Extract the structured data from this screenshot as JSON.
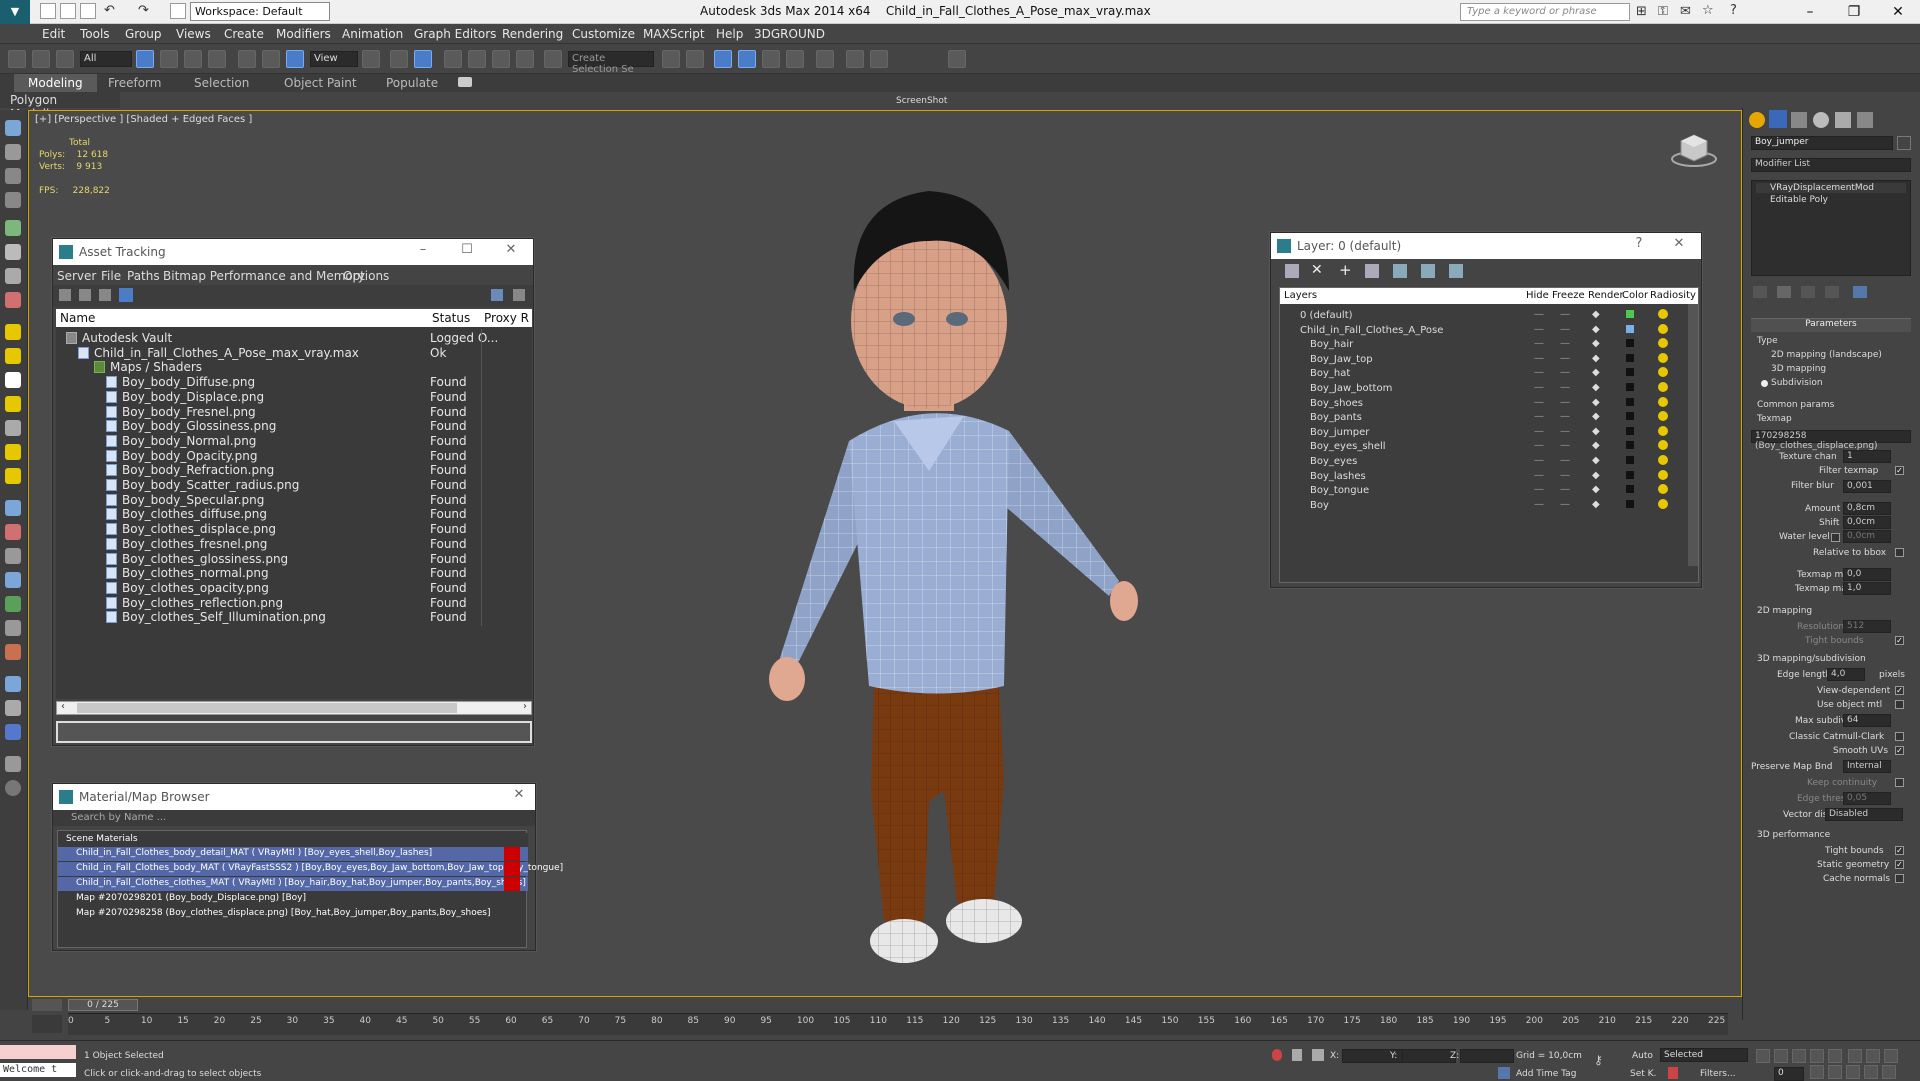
{
  "titlebar": {
    "workspace": "Workspace: Default",
    "app_title": "Autodesk 3ds Max  2014 x64",
    "file_title": "Child_in_Fall_Clothes_A_Pose_max_vray.max",
    "search_placeholder": "Type a keyword or phrase"
  },
  "menu": {
    "items": [
      "Edit",
      "Tools",
      "Group",
      "Views",
      "Create",
      "Modifiers",
      "Animation",
      "Graph Editors",
      "Rendering",
      "Customize",
      "MAXScript",
      "Help",
      "3DGROUND"
    ]
  },
  "toolbar": {
    "selection_filter": "All",
    "ref_coord": "View",
    "create_selection": "Create Selection Se",
    "screenshot_label": "ScreenShot"
  },
  "ribbon": {
    "tabs": [
      "Modeling",
      "Freeform",
      "Selection",
      "Object Paint",
      "Populate"
    ],
    "subtab": "Polygon Modeling"
  },
  "viewport": {
    "label": "[+] [Perspective ] [Shaded + Edged Faces ]",
    "stats_total": "Total",
    "polys_label": "Polys:",
    "polys_value": "12 618",
    "verts_label": "Verts:",
    "verts_value": "9 913",
    "fps_label": "FPS:",
    "fps_value": "228,822"
  },
  "asset_tracking": {
    "title": "Asset Tracking",
    "menu": [
      "Server",
      "File",
      "Paths",
      "Bitmap Performance and Memory",
      "Options"
    ],
    "columns": [
      "Name",
      "Status",
      "Proxy R"
    ],
    "rows": [
      {
        "name": "Autodesk Vault",
        "status": "Logged O..."
      },
      {
        "name": "Child_in_Fall_Clothes_A_Pose_max_vray.max",
        "status": "Ok"
      },
      {
        "name": "Maps / Shaders",
        "status": ""
      },
      {
        "name": "Boy_body_Diffuse.png",
        "status": "Found"
      },
      {
        "name": "Boy_body_Displace.png",
        "status": "Found"
      },
      {
        "name": "Boy_body_Fresnel.png",
        "status": "Found"
      },
      {
        "name": "Boy_body_Glossiness.png",
        "status": "Found"
      },
      {
        "name": "Boy_body_Normal.png",
        "status": "Found"
      },
      {
        "name": "Boy_body_Opacity.png",
        "status": "Found"
      },
      {
        "name": "Boy_body_Refraction.png",
        "status": "Found"
      },
      {
        "name": "Boy_body_Scatter_radius.png",
        "status": "Found"
      },
      {
        "name": "Boy_body_Specular.png",
        "status": "Found"
      },
      {
        "name": "Boy_clothes_diffuse.png",
        "status": "Found"
      },
      {
        "name": "Boy_clothes_displace.png",
        "status": "Found"
      },
      {
        "name": "Boy_clothes_fresnel.png",
        "status": "Found"
      },
      {
        "name": "Boy_clothes_glossiness.png",
        "status": "Found"
      },
      {
        "name": "Boy_clothes_normal.png",
        "status": "Found"
      },
      {
        "name": "Boy_clothes_opacity.png",
        "status": "Found"
      },
      {
        "name": "Boy_clothes_reflection.png",
        "status": "Found"
      },
      {
        "name": "Boy_clothes_Self_Illumination.png",
        "status": "Found"
      }
    ]
  },
  "layer_panel": {
    "title": "Layer: 0 (default)",
    "columns": [
      "Layers",
      "Hide",
      "Freeze",
      "Render",
      "Color",
      "Radiosity"
    ],
    "rows": [
      {
        "name": "0 (default)",
        "color": "#4ec84e"
      },
      {
        "name": "Child_in_Fall_Clothes_A_Pose",
        "color": "#7ab0e8"
      },
      {
        "name": "Boy_hair",
        "color": "#111111"
      },
      {
        "name": "Boy_Jaw_top",
        "color": "#111111"
      },
      {
        "name": "Boy_hat",
        "color": "#111111"
      },
      {
        "name": "Boy_Jaw_bottom",
        "color": "#111111"
      },
      {
        "name": "Boy_shoes",
        "color": "#111111"
      },
      {
        "name": "Boy_pants",
        "color": "#111111"
      },
      {
        "name": "Boy_jumper",
        "color": "#111111"
      },
      {
        "name": "Boy_eyes_shell",
        "color": "#111111"
      },
      {
        "name": "Boy_eyes",
        "color": "#111111"
      },
      {
        "name": "Boy_lashes",
        "color": "#111111"
      },
      {
        "name": "Boy_tongue",
        "color": "#111111"
      },
      {
        "name": "Boy",
        "color": "#111111"
      }
    ]
  },
  "material_browser": {
    "title": "Material/Map Browser",
    "search_placeholder": "Search by Name ...",
    "group": "Scene Materials",
    "rows": [
      "Child_in_Fall_Clothes_body_detail_MAT ( VRayMtl ) [Boy_eyes_shell,Boy_lashes]",
      "Child_in_Fall_Clothes_body_MAT ( VRayFastSSS2 ) [Boy,Boy_eyes,Boy_Jaw_bottom,Boy_Jaw_top,Boy_tongue]",
      "Child_in_Fall_Clothes_clothes_MAT ( VRayMtl ) [Boy_hair,Boy_hat,Boy_jumper,Boy_pants,Boy_shoes]",
      "Map #2070298201 (Boy_body_Displace.png) [Boy]",
      "Map #2070298258 (Boy_clothes_displace.png) [Boy_hat,Boy_jumper,Boy_pants,Boy_shoes]"
    ]
  },
  "command_panel": {
    "object_name": "Boy_jumper",
    "modifier_list": "Modifier List",
    "stack": [
      "VRayDisplacementMod",
      "Editable Poly"
    ],
    "parameters": "Parameters",
    "type_label": "Type",
    "type_options": [
      "2D mapping (landscape)",
      "3D mapping",
      "Subdivision"
    ],
    "common_params": "Common params",
    "texmap_label": "Texmap",
    "texmap_value": "170298258 (Boy_clothes_displace.png)",
    "texture_chan_label": "Texture chan",
    "texture_chan_value": "1",
    "filter_texmap": "Filter texmap",
    "filter_blur_label": "Filter blur",
    "filter_blur_value": "0,001",
    "amount_label": "Amount",
    "amount_value": "0,8cm",
    "shift_label": "Shift",
    "shift_value": "0,0cm",
    "water_level_label": "Water level",
    "water_level_value": "0,0cm",
    "relative_bbox": "Relative to bbox",
    "texmap_min_label": "Texmap min",
    "texmap_min_value": "0,0",
    "texmap_max_label": "Texmap max",
    "texmap_max_value": "1,0",
    "mapping2d": "2D mapping",
    "resolution_label": "Resolution",
    "resolution_value": "512",
    "tight_bounds": "Tight bounds",
    "mapping3d": "3D mapping/subdivision",
    "edge_length_label": "Edge length",
    "edge_length_value": "4,0",
    "pixels": "pixels",
    "view_dependent": "View-dependent",
    "use_object_mtl": "Use object mtl",
    "max_subdivs_label": "Max subdivs",
    "max_subdivs_value": "64",
    "classic_catmull": "Classic Catmull-Clark",
    "smooth_uvs": "Smooth UVs",
    "preserve_map_bnd": "Preserve Map Bnd",
    "preserve_value": "Internal",
    "keep_continuity": "Keep continuity",
    "edge_thresh_label": "Edge thresh",
    "edge_thresh_value": "0,05",
    "vector_displ_label": "Vector displ",
    "vector_displ_value": "Disabled",
    "perf": "3D performance",
    "perf_tight": "Tight bounds",
    "static_geo": "Static geometry",
    "cache_normals": "Cache normals"
  },
  "timeline": {
    "slider": "0 / 225",
    "ticks": [
      "0",
      "5",
      "10",
      "15",
      "20",
      "25",
      "30",
      "35",
      "40",
      "45",
      "50",
      "55",
      "60",
      "65",
      "70",
      "75",
      "80",
      "85",
      "90",
      "95",
      "100",
      "105",
      "110",
      "115",
      "120",
      "125",
      "130",
      "135",
      "140",
      "145",
      "150",
      "155",
      "160",
      "165",
      "170",
      "175",
      "180",
      "185",
      "190",
      "195",
      "200",
      "205",
      "210",
      "215",
      "220",
      "225"
    ]
  },
  "status": {
    "maxscript_text": "Welcome t",
    "selected": "1 Object Selected",
    "hint": "Click or click-and-drag to select objects",
    "x_label": "X:",
    "y_label": "Y:",
    "z_label": "Z:",
    "grid": "Grid = 10,0cm",
    "add_time_tag": "Add Time Tag",
    "auto": "Auto",
    "selected_dropdown": "Selected",
    "set_k": "Set K.",
    "filters": "Filters...",
    "frame": "0"
  }
}
